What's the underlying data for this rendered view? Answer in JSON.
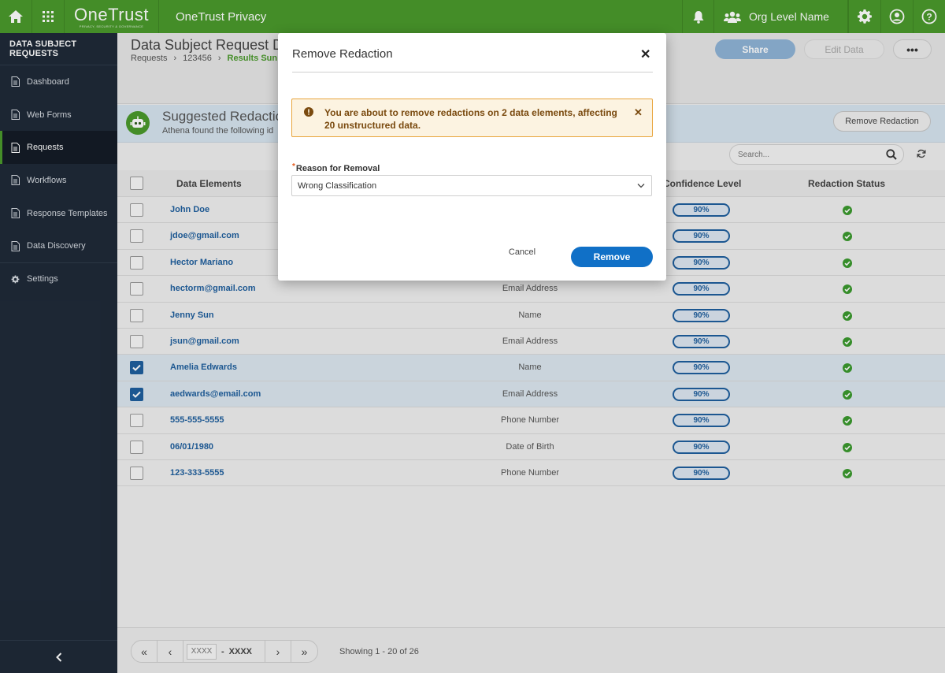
{
  "topbar": {
    "logo": "OneTrust",
    "logo_tagline": "PRIVACY, SECURITY & GOVERNANCE",
    "app_name": "OneTrust Privacy",
    "org_name": "Org Level Name"
  },
  "sidebar": {
    "title": "DATA SUBJECT REQUESTS",
    "items": [
      {
        "label": "Dashboard",
        "icon": "document-icon"
      },
      {
        "label": "Web Forms",
        "icon": "document-icon"
      },
      {
        "label": "Requests",
        "icon": "document-icon",
        "active": true
      },
      {
        "label": "Workflows",
        "icon": "document-icon"
      },
      {
        "label": "Response Templates",
        "icon": "document-icon"
      },
      {
        "label": "Data Discovery",
        "icon": "document-icon"
      },
      {
        "label": "Settings",
        "icon": "gear-icon"
      }
    ]
  },
  "header": {
    "title": "Data Subject Request De",
    "breadcrumb": [
      "Requests",
      "123456",
      "Results Sun"
    ],
    "share_label": "Share",
    "edit_label": "Edit Data",
    "more_label": "•••"
  },
  "suggest": {
    "title": "Suggested Redactio",
    "subtitle": "Athena found the following id",
    "remove_label": "Remove Redaction",
    "search_placeholder": "Search..."
  },
  "table": {
    "headers": {
      "elements": "Data Elements",
      "confidence": "Confidence Level",
      "status": "Redaction Status"
    },
    "rows": [
      {
        "element": "John Doe",
        "type": "",
        "confidence": "90%",
        "checked": false
      },
      {
        "element": "jdoe@gmail.com",
        "type": "",
        "confidence": "90%",
        "checked": false
      },
      {
        "element": "Hector Mariano",
        "type": "",
        "confidence": "90%",
        "checked": false
      },
      {
        "element": "hectorm@gmail.com",
        "type": "Email Address",
        "confidence": "90%",
        "checked": false
      },
      {
        "element": "Jenny Sun",
        "type": "Name",
        "confidence": "90%",
        "checked": false
      },
      {
        "element": "jsun@gmail.com",
        "type": "Email Address",
        "confidence": "90%",
        "checked": false
      },
      {
        "element": "Amelia Edwards",
        "type": "Name",
        "confidence": "90%",
        "checked": true
      },
      {
        "element": "aedwards@email.com",
        "type": "Email Address",
        "confidence": "90%",
        "checked": true
      },
      {
        "element": "555-555-5555",
        "type": "Phone Number",
        "confidence": "90%",
        "checked": false
      },
      {
        "element": "06/01/1980",
        "type": "Date of Birth",
        "confidence": "90%",
        "checked": false
      },
      {
        "element": "123-333-5555",
        "type": "Phone Number",
        "confidence": "90%",
        "checked": false
      }
    ]
  },
  "pager": {
    "from_placeholder": "XXXX",
    "dash": "-",
    "to_value": "XXXX",
    "summary": "Showing 1 - 20 of 26"
  },
  "modal": {
    "title": "Remove Redaction",
    "alert_text": "You are about to remove redactions on 2 data elements, affecting 20 unstructured data.",
    "field_label": "Reason for Removal",
    "required_mark": "*",
    "select_value": "Wrong Classification",
    "cancel_label": "Cancel",
    "remove_label": "Remove"
  },
  "colors": {
    "brand_green": "#4a9a2c",
    "primary_blue": "#1070c7",
    "link_blue": "#1f5f9e",
    "sidebar_bg": "#1f2a38",
    "warning_border": "#e8a53d",
    "success_green": "#3b9a2e"
  }
}
